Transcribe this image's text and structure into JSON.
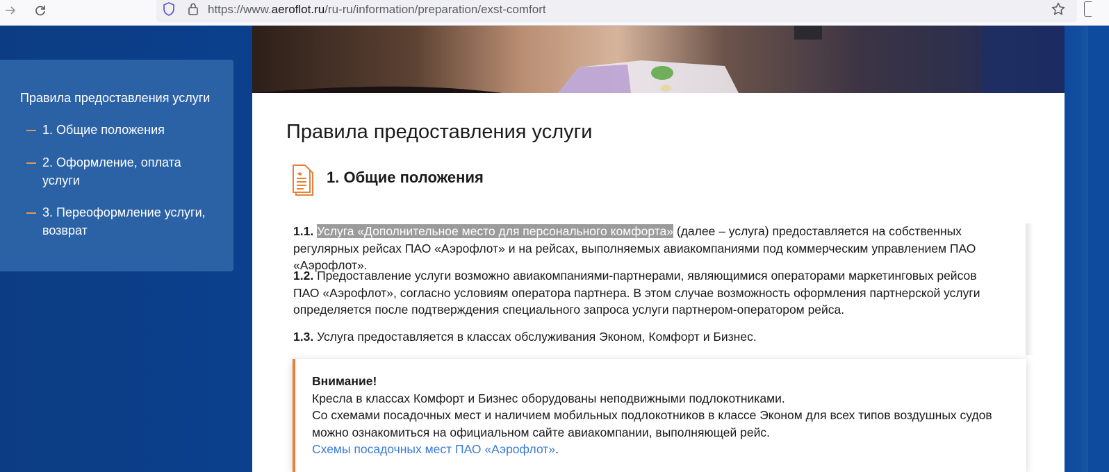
{
  "browser": {
    "url_prefix": "https://www.",
    "url_domain": "aeroflot.ru",
    "url_path": "/ru-ru/information/preparation/exst-comfort"
  },
  "sidebar": {
    "title": "Правила предоставления услуги",
    "items": [
      {
        "label": "1. Общие положения"
      },
      {
        "label": "2. Оформление, оплата услуги"
      },
      {
        "label": "3. Переоформление услуги, возврат"
      }
    ]
  },
  "main": {
    "title": "Правила предоставления услуги",
    "section_title": "1. Общие положения",
    "p1_num": "1.1.",
    "p1_highlight": "Услуга «Дополнительное место для персонального комфорта»",
    "p1_rest": " (далее – услуга) предоставляется на собственных регулярных рейсах ПАО «Аэрофлот» и на рейсах, выполняемых авиакомпаниями под коммерческим управлением ПАО «Аэрофлот».",
    "p2_num": "1.2.",
    "p2_text": " Предоставление услуги возможно авиакомпаниями-партнерами, являющимися операторами маркетинговых рейсов ПАО «Аэрофлот», согласно условиям оператора партнера. В этом случае возможность оформления партнерской услуги определяется после подтверждения специального запроса услуги партнером-оператором рейса.",
    "p3_num": "1.3.",
    "p3_text": " Услуга предоставляется в классах обслуживания Эконом, Комфорт и Бизнес."
  },
  "notice": {
    "heading": "Внимание!",
    "line1": "Кресла в классах Комфорт и Бизнес оборудованы неподвижными подлокотниками.",
    "line2": "Со схемами посадочных мест и наличием мобильных подлокотников в классе Эконом для всех типов воздушных судов можно ознакомиться на официальном сайте авиакомпании, выполняющей рейс.",
    "link": "Схемы посадочных мест ПАО «Аэрофлот»",
    "link_suffix": "."
  },
  "colors": {
    "brand_blue": "#0b3f86",
    "sidebar_blue": "#2b62a6",
    "accent_orange": "#e7803a",
    "link_blue": "#3a7bd5"
  }
}
